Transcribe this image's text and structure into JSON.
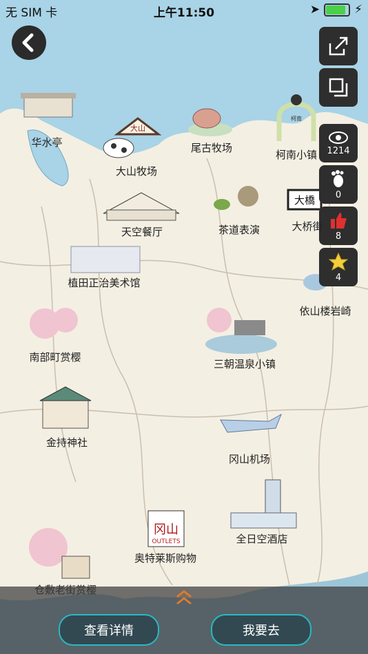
{
  "status_bar": {
    "carrier": "无 SIM 卡",
    "time": "上午11:50"
  },
  "side_stats": [
    {
      "icon": "eye-icon",
      "count": "1214"
    },
    {
      "icon": "footprint-icon",
      "count": "0"
    },
    {
      "icon": "thumbs-up-icon",
      "count": "8"
    },
    {
      "icon": "star-icon",
      "count": "4"
    }
  ],
  "pois": [
    {
      "label": "华水亭"
    },
    {
      "label": "大山牧场"
    },
    {
      "label": "尾古牧场"
    },
    {
      "label": "柯南小镇"
    },
    {
      "label": "天空餐厅"
    },
    {
      "label": "茶道表演"
    },
    {
      "label": "大桥街"
    },
    {
      "label": "植田正治美术馆"
    },
    {
      "label": "依山楼岩崎"
    },
    {
      "label": "南部町赏樱"
    },
    {
      "label": "三朝温泉小镇"
    },
    {
      "label": "金持神社"
    },
    {
      "label": "冈山机场"
    },
    {
      "label": "奥特莱斯购物"
    },
    {
      "label": "全日空酒店"
    },
    {
      "label": "仓敷老街赏樱"
    }
  ],
  "signs": {
    "daisen": "大山",
    "conan": "柯南",
    "ohashi": "大橋",
    "outlet_brand": "冈山",
    "outlet_sub": "OUTLETS"
  },
  "buttons": {
    "details": "查看详情",
    "go": "我要去"
  },
  "colors": {
    "sea": "#a9d3e6",
    "land": "#f4efe3",
    "accent": "#2ab8c2",
    "chevron": "#e07a2a"
  }
}
